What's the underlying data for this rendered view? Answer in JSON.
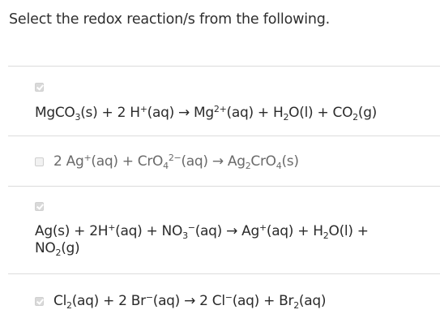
{
  "question": {
    "prompt": "Select the redox reaction/s from the following."
  },
  "options": [
    {
      "checked": true,
      "parts": {
        "a1": "MgCO",
        "a2": "3",
        "a3": "(s) + 2 H",
        "a4": "+",
        "a5": "(aq) → Mg",
        "a6": "2+",
        "a7": "(aq) + H",
        "a8": "2",
        "a9": "O(l) + CO",
        "a10": "2",
        "a11": "(g)"
      }
    },
    {
      "checked": false,
      "parts": {
        "b1": "2 Ag",
        "b2": "+",
        "b3": "(aq) + CrO",
        "b4": "4",
        "b5": "2−",
        "b6": "(aq) → Ag",
        "b7": "2",
        "b8": "CrO",
        "b9": "4",
        "b10": "(s)"
      }
    },
    {
      "checked": true,
      "parts": {
        "c1": "Ag(s) + 2H",
        "c2": "+",
        "c3": "(aq) + NO",
        "c4": "3",
        "c5": "−",
        "c6": "(aq) → Ag",
        "c7": "+",
        "c8": "(aq) + H",
        "c9": "2",
        "c10": "O(l) +",
        "c11": "NO",
        "c12": "2",
        "c13": "(g)"
      }
    },
    {
      "checked": true,
      "parts": {
        "d1": "Cl",
        "d2": "2",
        "d3": "(aq) + 2 Br",
        "d4": "−",
        "d5": "(aq) → 2 Cl",
        "d6": "−",
        "d7": "(aq) + Br",
        "d8": "2",
        "d9": "(aq)"
      }
    }
  ],
  "colors": {
    "divider": "#dcdcdc",
    "checkbox_checked": "#d9d9d9",
    "text": "#2b2b2b"
  }
}
